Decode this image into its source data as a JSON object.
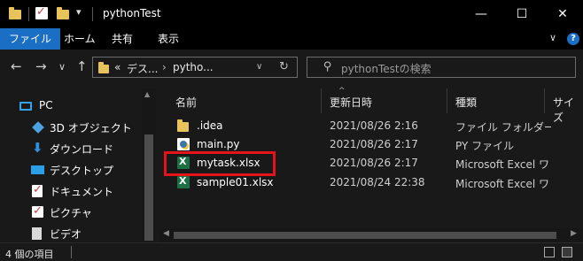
{
  "window": {
    "title": "pythonTest",
    "minimize_glyph": "—",
    "maximize_glyph": "☐",
    "close_glyph": "✕"
  },
  "ribbon": {
    "tabs": [
      "ファイル",
      "ホーム",
      "共有",
      "表示"
    ],
    "active_tab": "ファイル",
    "collapse_glyph": "∨",
    "help_glyph": "?"
  },
  "nav": {
    "back": "←",
    "forward": "→",
    "recent": "∨",
    "up": "↑",
    "address_prefix": "«",
    "breadcrumb": [
      "デス...",
      "pytho..."
    ],
    "crumb_sep": "›",
    "dropdown_glyph": "∨",
    "refresh_glyph": "↻",
    "search_placeholder": "pythonTestの検索",
    "search_glyph": "⚲"
  },
  "sidebar": {
    "items": [
      {
        "label": "PC",
        "icon": "pc-icon",
        "color": "#35a4e8"
      },
      {
        "label": "3D オブジェクト",
        "icon": "3d-objects-icon",
        "color": "#4aa3e0"
      },
      {
        "label": "ダウンロード",
        "icon": "download-icon",
        "color": "#2f8fe0"
      },
      {
        "label": "デスクトップ",
        "icon": "desktop-icon",
        "color": "#2c9ee6"
      },
      {
        "label": "ドキュメント",
        "icon": "documents-icon",
        "color": "#d9d9d9"
      },
      {
        "label": "ピクチャ",
        "icon": "pictures-icon",
        "color": "#d9d9d9"
      },
      {
        "label": "ビデオ",
        "icon": "videos-icon",
        "color": "#d9d9d9"
      }
    ]
  },
  "columns": [
    "名前",
    "更新日時",
    "種類",
    "サイズ"
  ],
  "sort_indicator": "^",
  "files": [
    {
      "name": ".idea",
      "date": "2021/08/26 2:16",
      "type": "ファイル フォルダー",
      "icon": "folder-icon"
    },
    {
      "name": "main.py",
      "date": "2021/08/26 2:17",
      "type": "PY ファイル",
      "icon": "python-file-icon"
    },
    {
      "name": "mytask.xlsx",
      "date": "2021/08/26 2:17",
      "type": "Microsoft Excel ワ",
      "icon": "excel-file-icon"
    },
    {
      "name": "sample01.xlsx",
      "date": "2021/08/24 22:38",
      "type": "Microsoft Excel ワ",
      "icon": "excel-file-icon"
    }
  ],
  "highlighted_file": "mytask.xlsx",
  "status": {
    "item_count": "4 個の項目"
  },
  "colors": {
    "accent": "#1a6ec4",
    "highlight_box": "#e5141b",
    "folder": "#e8c25a",
    "excel": "#1d7044"
  }
}
